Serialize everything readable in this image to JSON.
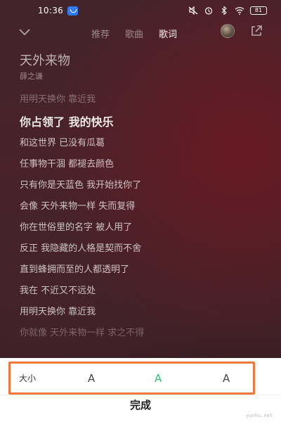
{
  "status_bar": {
    "time": "10:36",
    "battery": "81"
  },
  "nav": {
    "tabs": [
      {
        "label": "推荐",
        "active": false
      },
      {
        "label": "歌曲",
        "active": false
      },
      {
        "label": "歌词",
        "active": true
      }
    ]
  },
  "song": {
    "title": "天外来物",
    "artist": "薛之谦"
  },
  "lyrics": [
    {
      "text": "用明天换你 靠近我",
      "state": "dim"
    },
    {
      "text": "你占领了 我的快乐",
      "state": "current"
    },
    {
      "text": "和这世界 已没有瓜葛",
      "state": "normal"
    },
    {
      "text": "任事物干涸 都褪去颜色",
      "state": "normal"
    },
    {
      "text": "只有你是天蓝色 我开始找你了",
      "state": "normal"
    },
    {
      "text": "会像 天外来物一样 失而复得",
      "state": "normal"
    },
    {
      "text": "你在世俗里的名字 被人用了",
      "state": "normal"
    },
    {
      "text": "反正 我隐藏的人格是契而不舍",
      "state": "normal"
    },
    {
      "text": "直到蜂拥而至的人都透明了",
      "state": "normal"
    },
    {
      "text": "我在 不近又不远处",
      "state": "normal"
    },
    {
      "text": "用明天换你 靠近我",
      "state": "normal"
    },
    {
      "text": "你就像 天外来物一样 求之不得",
      "state": "fade"
    }
  ],
  "size_panel": {
    "label": "大小",
    "options": [
      "A",
      "A",
      "A"
    ],
    "selected": "medium",
    "accent_color": "#2fbf74",
    "highlight_color": "#f07a3c"
  },
  "done_label": "完成",
  "watermark": "yunhu.net"
}
